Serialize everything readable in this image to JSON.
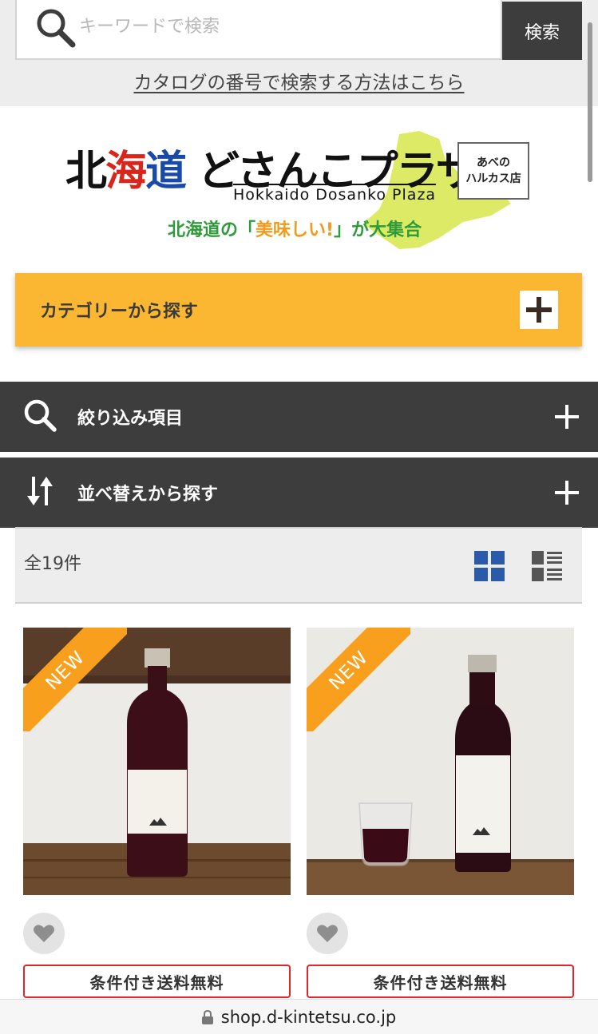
{
  "search": {
    "placeholder": "キーワードで検索",
    "button_label": "検索",
    "catalog_link": "カタログの番号で検索する方法はこちら"
  },
  "logo": {
    "title_part1": "北",
    "title_part2": "海",
    "title_part3": "道",
    "title_part4": "どさんこプラザ",
    "subtitle": "Hokkaido Dosanko Plaza",
    "store_line1": "あべの",
    "store_line2": "ハルカス店",
    "tagline_start": "北海道の「",
    "tagline_highlight": "美味しい!",
    "tagline_end": "」が大集合"
  },
  "category": {
    "label": "カテゴリーから探す"
  },
  "filter": {
    "label": "絞り込み項目"
  },
  "sort": {
    "label": "並べ替えから探す"
  },
  "results": {
    "count_label": "全19件"
  },
  "products": [
    {
      "badge": "NEW",
      "shipping": "条件付き送料無料",
      "icon": "heart-icon"
    },
    {
      "badge": "NEW",
      "shipping": "条件付き送料無料",
      "icon": "heart-icon"
    }
  ],
  "browser": {
    "url": "shop.d-kintetsu.co.jp"
  },
  "colors": {
    "category_bg": "#fbb732",
    "dark_row_bg": "#3d3d3d",
    "view_icon_active": "#2a5aa8",
    "new_ribbon": "#f8a01e",
    "shipping_border": "#e0252b"
  }
}
